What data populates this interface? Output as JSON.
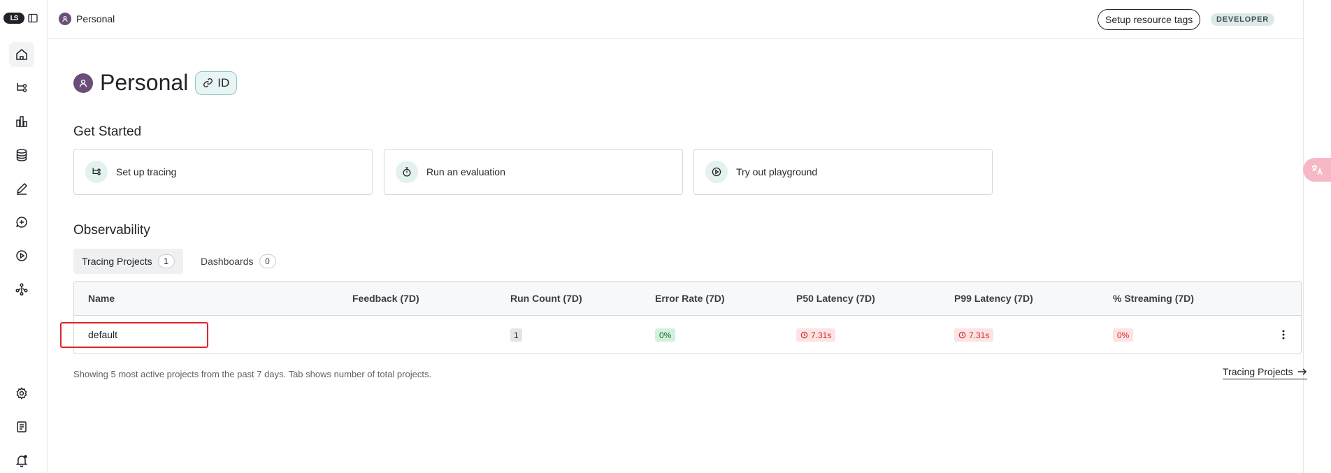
{
  "header": {
    "breadcrumb": "Personal",
    "setup_tags_label": "Setup resource tags",
    "env_badge": "DEVELOPER"
  },
  "page": {
    "title": "Personal",
    "id_chip_label": "ID"
  },
  "get_started": {
    "title": "Get Started",
    "cards": [
      {
        "label": "Set up tracing",
        "icon": "tracing-icon"
      },
      {
        "label": "Run an evaluation",
        "icon": "stopwatch-icon"
      },
      {
        "label": "Try out playground",
        "icon": "play-circle-icon"
      }
    ]
  },
  "observability": {
    "title": "Observability",
    "tabs": [
      {
        "label": "Tracing Projects",
        "count": "1",
        "active": true
      },
      {
        "label": "Dashboards",
        "count": "0",
        "active": false
      }
    ],
    "table": {
      "columns": [
        "Name",
        "Feedback (7D)",
        "Run Count (7D)",
        "Error Rate (7D)",
        "P50 Latency (7D)",
        "P99 Latency (7D)",
        "% Streaming (7D)"
      ],
      "rows": [
        {
          "name": "default",
          "feedback": "",
          "run_count": "1",
          "error_rate": "0%",
          "p50": "7.31s",
          "p99": "7.31s",
          "streaming": "0%"
        }
      ]
    },
    "footnote": "Showing 5 most active projects from the past 7 days. Tab shows number of total projects.",
    "link_label": "Tracing Projects"
  },
  "sidebar": {
    "items": [
      "home-icon",
      "tracing-icon",
      "dashboards-icon",
      "datasets-icon",
      "annotation-icon",
      "prompts-icon",
      "playground-icon",
      "deployments-icon",
      "settings-icon",
      "docs-icon",
      "notifications-icon"
    ]
  },
  "colors": {
    "accent_teal": "#8fc6c2",
    "avatar": "#6b4d7a",
    "error_red": "#c8312c",
    "success_green": "#146b2f",
    "highlight_box": "#e02424"
  }
}
